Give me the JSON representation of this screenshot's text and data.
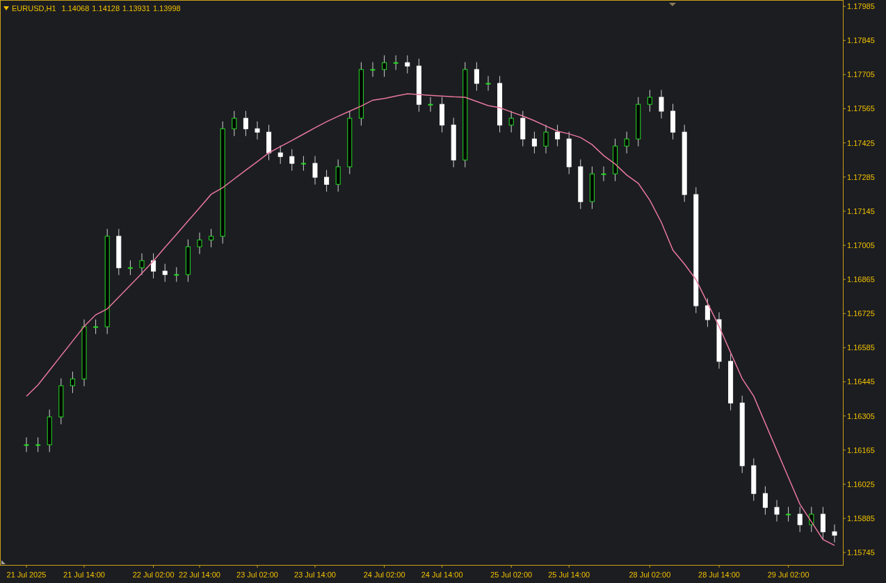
{
  "header": {
    "symbol": "EURUSD,H1",
    "ohlc": [
      "1.14068",
      "1.14128",
      "1.13931",
      "1.13998"
    ]
  },
  "chart": {
    "chart_data": {
      "type": "candlestick",
      "ylim": [
        1.15694,
        1.18011
      ],
      "categories": [
        "21 Jul 2025",
        null,
        null,
        null,
        null,
        "21 Jul 14:00",
        null,
        null,
        null,
        null,
        null,
        "22 Jul 02:00",
        null,
        null,
        null,
        "22 Jul 14:00",
        null,
        null,
        null,
        null,
        "23 Jul 02:00",
        null,
        null,
        null,
        null,
        "23 Jul 14:00",
        null,
        null,
        null,
        null,
        null,
        "24 Jul 02:00",
        null,
        null,
        null,
        null,
        "24 Jul 14:00",
        null,
        null,
        null,
        null,
        null,
        "25 Jul 02:00",
        null,
        null,
        null,
        null,
        "25 Jul 14:00",
        null,
        null,
        null,
        null,
        null,
        null,
        "28 Jul 02:00",
        null,
        null,
        null,
        null,
        null,
        "28 Jul 14:00",
        null,
        null,
        null,
        null,
        null,
        "29 Jul 02:00",
        null,
        null,
        null,
        null
      ],
      "ohlc": [
        [
          1.16187,
          1.16217,
          1.16157,
          1.16187
        ],
        [
          1.16187,
          1.16217,
          1.16157,
          1.16187
        ],
        [
          1.16187,
          1.16331,
          1.16157,
          1.16301
        ],
        [
          1.16301,
          1.16459,
          1.16271,
          1.16429
        ],
        [
          1.16429,
          1.16487,
          1.16399,
          1.16457
        ],
        [
          1.16457,
          1.16701,
          1.16427,
          1.16671
        ],
        [
          1.16671,
          1.16701,
          1.16641,
          1.16671
        ],
        [
          1.16671,
          1.17072,
          1.16641,
          1.17042
        ],
        [
          1.17042,
          1.17072,
          1.16883,
          1.16913
        ],
        [
          1.16913,
          1.16943,
          1.16883,
          1.16913
        ],
        [
          1.16913,
          1.16972,
          1.16883,
          1.16942
        ],
        [
          1.16942,
          1.16972,
          1.16869,
          1.16899
        ],
        [
          1.16899,
          1.16929,
          1.16855,
          1.16885
        ],
        [
          1.16885,
          1.16915,
          1.16855,
          1.16885
        ],
        [
          1.16885,
          1.17029,
          1.16855,
          1.16999
        ],
        [
          1.16999,
          1.17057,
          1.16969,
          1.17027
        ],
        [
          1.17027,
          1.17072,
          1.16997,
          1.17042
        ],
        [
          1.17042,
          1.17513,
          1.17012,
          1.17483
        ],
        [
          1.17483,
          1.17556,
          1.17453,
          1.17526
        ],
        [
          1.17526,
          1.17556,
          1.17453,
          1.17483
        ],
        [
          1.17483,
          1.17513,
          1.17439,
          1.17469
        ],
        [
          1.17469,
          1.17499,
          1.17354,
          1.17384
        ],
        [
          1.17384,
          1.17414,
          1.17339,
          1.17369
        ],
        [
          1.17369,
          1.17399,
          1.17311,
          1.17341
        ],
        [
          1.17341,
          1.17371,
          1.17311,
          1.17341
        ],
        [
          1.17341,
          1.17371,
          1.17254,
          1.17284
        ],
        [
          1.17284,
          1.17314,
          1.17225,
          1.17255
        ],
        [
          1.17255,
          1.17357,
          1.17225,
          1.17327
        ],
        [
          1.17327,
          1.17556,
          1.17297,
          1.17526
        ],
        [
          1.17526,
          1.17756,
          1.17496,
          1.17726
        ],
        [
          1.17726,
          1.17756,
          1.17696,
          1.17726
        ],
        [
          1.17726,
          1.17784,
          1.17696,
          1.17754
        ],
        [
          1.17754,
          1.17784,
          1.17724,
          1.17754
        ],
        [
          1.17754,
          1.17784,
          1.1771,
          1.1774
        ],
        [
          1.1774,
          1.1777,
          1.17553,
          1.17583
        ],
        [
          1.17583,
          1.17613,
          1.17553,
          1.17583
        ],
        [
          1.17583,
          1.17613,
          1.17468,
          1.17498
        ],
        [
          1.17498,
          1.17528,
          1.17325,
          1.17355
        ],
        [
          1.17355,
          1.17756,
          1.17325,
          1.17726
        ],
        [
          1.17726,
          1.17756,
          1.17639,
          1.17669
        ],
        [
          1.17669,
          1.17699,
          1.17639,
          1.17669
        ],
        [
          1.17669,
          1.17699,
          1.17468,
          1.17498
        ],
        [
          1.17498,
          1.17556,
          1.17468,
          1.17526
        ],
        [
          1.17526,
          1.17556,
          1.17411,
          1.17441
        ],
        [
          1.17441,
          1.17471,
          1.17382,
          1.17412
        ],
        [
          1.17412,
          1.17499,
          1.17382,
          1.17469
        ],
        [
          1.17469,
          1.17499,
          1.17411,
          1.17441
        ],
        [
          1.17441,
          1.17471,
          1.17297,
          1.17327
        ],
        [
          1.17327,
          1.17357,
          1.17154,
          1.17184
        ],
        [
          1.17184,
          1.17328,
          1.17154,
          1.17298
        ],
        [
          1.17298,
          1.17328,
          1.17268,
          1.17298
        ],
        [
          1.17298,
          1.17442,
          1.17268,
          1.17412
        ],
        [
          1.17412,
          1.17471,
          1.17382,
          1.17441
        ],
        [
          1.17441,
          1.17613,
          1.17411,
          1.17583
        ],
        [
          1.17583,
          1.17642,
          1.17553,
          1.17612
        ],
        [
          1.17612,
          1.17642,
          1.17525,
          1.17555
        ],
        [
          1.17555,
          1.17585,
          1.17439,
          1.17469
        ],
        [
          1.17469,
          1.17499,
          1.17183,
          1.17213
        ],
        [
          1.17213,
          1.17243,
          1.16727,
          1.16757
        ],
        [
          1.16757,
          1.16787,
          1.1667,
          1.167
        ],
        [
          1.167,
          1.1673,
          1.16499,
          1.16529
        ],
        [
          1.16529,
          1.16559,
          1.16328,
          1.16358
        ],
        [
          1.16358,
          1.16388,
          1.16071,
          1.16101
        ],
        [
          1.16101,
          1.16131,
          1.15957,
          1.15987
        ],
        [
          1.15987,
          1.16017,
          1.159,
          1.1593
        ],
        [
          1.1593,
          1.1596,
          1.15872,
          1.15902
        ],
        [
          1.15902,
          1.15932,
          1.15872,
          1.15902
        ],
        [
          1.15902,
          1.15932,
          1.15829,
          1.15859
        ],
        [
          1.15859,
          1.15932,
          1.15829,
          1.15902
        ],
        [
          1.15902,
          1.15932,
          1.158,
          1.1583
        ],
        [
          1.1583,
          1.1586,
          1.15786,
          1.15816
        ]
      ],
      "series": [
        {
          "type": "line",
          "color": "#e8789c",
          "values": [
            1.16386,
            1.16432,
            1.16492,
            1.16552,
            1.16612,
            1.16672,
            1.1672,
            1.16744,
            1.16793,
            1.16841,
            1.1689,
            1.16941,
            1.16996,
            1.1705,
            1.17105,
            1.17159,
            1.17214,
            1.17241,
            1.17277,
            1.17313,
            1.17348,
            1.17384,
            1.1741,
            1.17435,
            1.17461,
            1.17487,
            1.17512,
            1.17534,
            1.17555,
            1.17576,
            1.176,
            1.17607,
            1.17617,
            1.17626,
            1.17623,
            1.1762,
            1.17617,
            1.17614,
            1.17612,
            1.17595,
            1.17578,
            1.17569,
            1.17552,
            1.17535,
            1.17516,
            1.17494,
            1.17473,
            1.17462,
            1.17447,
            1.17418,
            1.17373,
            1.17338,
            1.17293,
            1.17259,
            1.1719,
            1.17099,
            1.16985,
            1.16928,
            1.16864,
            1.16768,
            1.16672,
            1.16565,
            1.16458,
            1.16386,
            1.16275,
            1.16164,
            1.16053,
            1.15943,
            1.15871,
            1.15798,
            1.15774
          ]
        }
      ],
      "yticks": [
        {
          "value": 1.17985,
          "label": "1.17985"
        },
        {
          "value": 1.17845,
          "label": "1.17845"
        },
        {
          "value": 1.17705,
          "label": "1.17705"
        },
        {
          "value": 1.17565,
          "label": "1.17565"
        },
        {
          "value": 1.17425,
          "label": "1.17425"
        },
        {
          "value": 1.17285,
          "label": "1.17285"
        },
        {
          "value": 1.17145,
          "label": "1.17145"
        },
        {
          "value": 1.17005,
          "label": "1.17005"
        },
        {
          "value": 1.16865,
          "label": "1.16865"
        },
        {
          "value": 1.16725,
          "label": "1.16725"
        },
        {
          "value": 1.16585,
          "label": "1.16585"
        },
        {
          "value": 1.16445,
          "label": "1.16445"
        },
        {
          "value": 1.16305,
          "label": "1.16305"
        },
        {
          "value": 1.16165,
          "label": "1.16165"
        },
        {
          "value": 1.16025,
          "label": "1.16025"
        },
        {
          "value": 1.15885,
          "label": "1.15885"
        },
        {
          "value": 1.15745,
          "label": "1.15745"
        }
      ]
    }
  }
}
